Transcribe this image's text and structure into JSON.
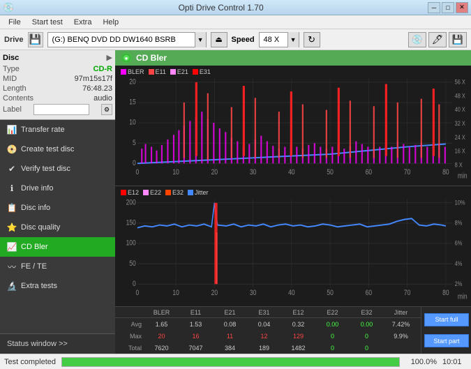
{
  "app": {
    "title": "Opti Drive Control 1.70",
    "icon": "💿"
  },
  "titlebar": {
    "minimize": "─",
    "maximize": "□",
    "close": "✕"
  },
  "menubar": {
    "items": [
      "File",
      "Start test",
      "Extra",
      "Help"
    ]
  },
  "drive": {
    "label": "Drive",
    "icon": "💾",
    "name": "(G:)  BENQ DVD DD DW1640 BSRB",
    "speed_label": "Speed",
    "speed_value": "48 X",
    "eject_icon": "⏏"
  },
  "disc": {
    "title": "Disc",
    "type_label": "Type",
    "type_value": "CD-R",
    "mid_label": "MID",
    "mid_value": "97m15s17f",
    "length_label": "Length",
    "length_value": "76:48.23",
    "contents_label": "Contents",
    "contents_value": "audio",
    "label_label": "Label",
    "label_value": ""
  },
  "sidebar": {
    "items": [
      {
        "id": "transfer-rate",
        "label": "Transfer rate",
        "icon": "📊"
      },
      {
        "id": "create-test-disc",
        "label": "Create test disc",
        "icon": "📀"
      },
      {
        "id": "verify-test-disc",
        "label": "Verify test disc",
        "icon": "✔"
      },
      {
        "id": "drive-info",
        "label": "Drive info",
        "icon": "ℹ"
      },
      {
        "id": "disc-info",
        "label": "Disc info",
        "icon": "📋"
      },
      {
        "id": "disc-quality",
        "label": "Disc quality",
        "icon": "⭐"
      },
      {
        "id": "cd-bler",
        "label": "CD Bler",
        "icon": "📈",
        "active": true
      },
      {
        "id": "fe-te",
        "label": "FE / TE",
        "icon": "〰"
      },
      {
        "id": "extra-tests",
        "label": "Extra tests",
        "icon": "🔬"
      }
    ]
  },
  "chart1": {
    "title": "CD Bler",
    "legend": [
      {
        "color": "#ff00ff",
        "label": "BLER"
      },
      {
        "color": "#ff4444",
        "label": "E11"
      },
      {
        "color": "#ff88ff",
        "label": "E21"
      },
      {
        "color": "#ff0000",
        "label": "E31"
      }
    ],
    "y_max": "20",
    "y_labels": [
      "20",
      "15",
      "10",
      "5",
      "0"
    ],
    "x_labels": [
      "0",
      "10",
      "20",
      "30",
      "40",
      "50",
      "60",
      "70",
      "80"
    ],
    "y2_labels": [
      "56 X",
      "48 X",
      "40 X",
      "32 X",
      "24 X",
      "16 X",
      "8 X"
    ],
    "x_unit": "min"
  },
  "chart2": {
    "legend": [
      {
        "color": "#ff0000",
        "label": "E12"
      },
      {
        "color": "#ff88ff",
        "label": "E22"
      },
      {
        "color": "#ff4400",
        "label": "E32"
      },
      {
        "color": "#4488ff",
        "label": "Jitter"
      }
    ],
    "y_labels": [
      "200",
      "150",
      "100",
      "50",
      "0"
    ],
    "x_labels": [
      "0",
      "10",
      "20",
      "30",
      "40",
      "50",
      "60",
      "70",
      "80"
    ],
    "y2_labels": [
      "10%",
      "8%",
      "6%",
      "4%",
      "2%"
    ],
    "x_unit": "min"
  },
  "stats": {
    "headers": [
      "",
      "BLER",
      "E11",
      "E21",
      "E31",
      "E12",
      "E22",
      "E32",
      "Jitter",
      ""
    ],
    "rows": [
      {
        "label": "Avg",
        "values": [
          "1.65",
          "1.53",
          "0.08",
          "0.04",
          "0.32",
          "0.00",
          "0.00",
          "7.42%"
        ],
        "btn": "Start full"
      },
      {
        "label": "Max",
        "values": [
          "20",
          "16",
          "11",
          "12",
          "129",
          "0",
          "0",
          "9.9%"
        ],
        "btn": "Start part"
      },
      {
        "label": "Total",
        "values": [
          "7620",
          "7047",
          "384",
          "189",
          "1482",
          "0",
          "0",
          ""
        ],
        "btn": ""
      }
    ]
  },
  "statusbar": {
    "text": "Test completed",
    "progress": 100,
    "progress_text": "100.0%",
    "time": "10:01"
  },
  "status_window_label": "Status window >>",
  "colors": {
    "green": "#22aa22",
    "blue": "#4488ff",
    "red": "#ff4444",
    "pink": "#ff88ff",
    "magenta": "#ff00ff"
  }
}
